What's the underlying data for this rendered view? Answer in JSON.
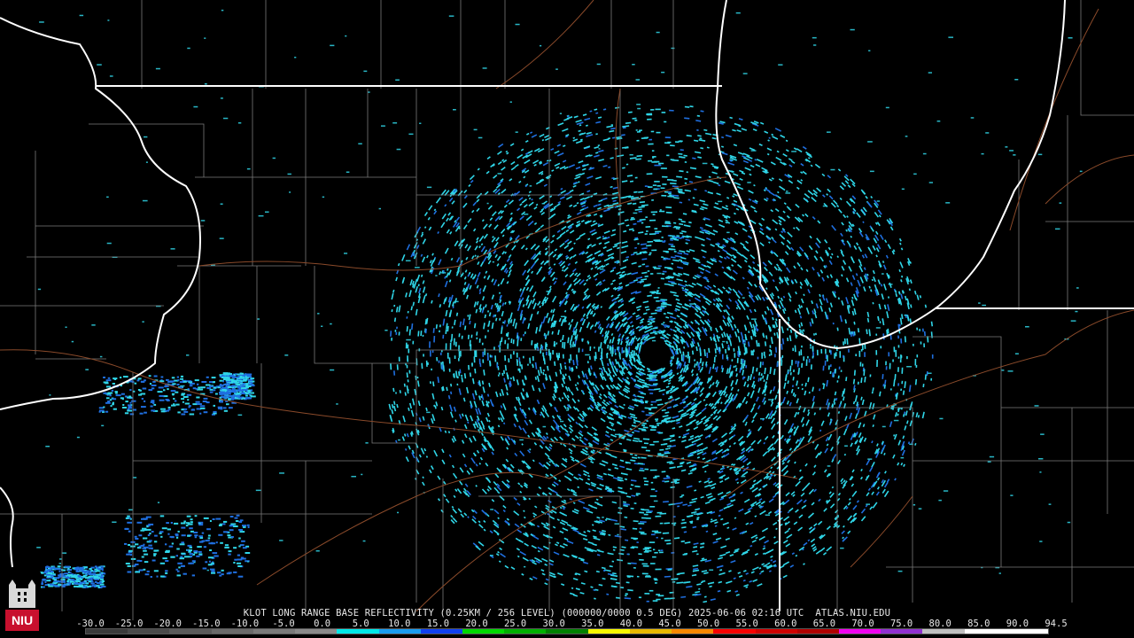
{
  "caption": "KLOT LONG RANGE BASE REFLECTIVITY (0.25KM / 256 LEVEL) (000000/0000 0.5 DEG) 2025-06-06 02:16 UTC  ATLAS.NIU.EDU",
  "logo_text": "NIU",
  "colors": {
    "background": "#000000",
    "state_border": "#ffffff",
    "county_line": "#7a7a7a",
    "road_line": "#8a4a2a",
    "echo_cyan": "#2fd6e8",
    "echo_blue": "#1f6fe0"
  },
  "scale": {
    "labels": [
      "-30.0",
      "-25.0",
      "-20.0",
      "-15.0",
      "-10.0",
      "-5.0",
      "0.0",
      "5.0",
      "10.0",
      "15.0",
      "20.0",
      "25.0",
      "30.0",
      "35.0",
      "40.0",
      "45.0",
      "50.0",
      "55.0",
      "60.0",
      "65.0",
      "70.0",
      "75.0",
      "80.0",
      "85.0",
      "90.0",
      "94.5"
    ],
    "colors": [
      "#3a3a3a",
      "#4a4a4a",
      "#5a5a5a",
      "#6a6a6a",
      "#7a7a7a",
      "#8a8a8a",
      "#00e8e8",
      "#1a9cf0",
      "#1040f0",
      "#00d800",
      "#00b000",
      "#008000",
      "#f8f800",
      "#e8b800",
      "#f88800",
      "#f80000",
      "#d00000",
      "#b00000",
      "#f000f0",
      "#9030d0",
      "#c0c0c0",
      "#ffffff",
      "#ffffff"
    ]
  }
}
